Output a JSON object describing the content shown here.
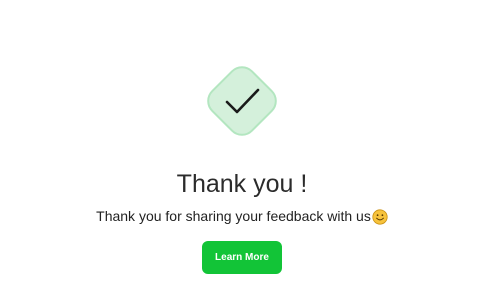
{
  "confirmation": {
    "icon": "checkmark-icon",
    "title": "Thank you !",
    "message": "Thank you for sharing your feedback with us",
    "message_emoji": "smiley-face-icon",
    "cta_label": "Learn More"
  },
  "colors": {
    "badge_fill": "#d4f0db",
    "badge_border": "#b3e6c0",
    "checkmark": "#1a1a1a",
    "button_bg": "#12c437",
    "button_text": "#ffffff",
    "emoji_fill": "#f7c33c"
  }
}
